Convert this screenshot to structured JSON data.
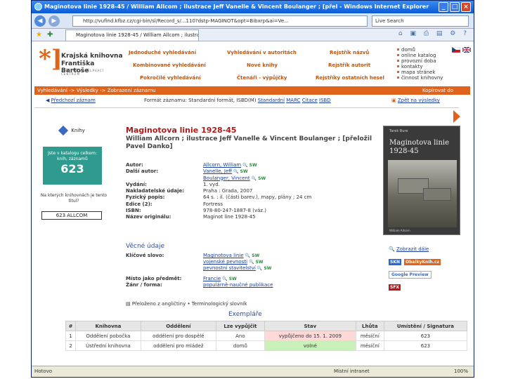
{
  "window": {
    "title": "Maginotova linie 1928-45 / William Allcom ; ilustrace Jeff Vanelle & Vincent Boulanger ; [přel - Windows Internet Explorer",
    "buttons": [
      "_",
      "□",
      "×"
    ]
  },
  "addressbar": {
    "url": "http://vufind.kfbz.cz/cgi-bin/sl/Record_s/...110?dstp-MAGINOT&opt=Bibxrp&ai=Ve...",
    "search_placeholder": "Live Search"
  },
  "tabbar": {
    "tab_label": "Maginotova linie 1928-45 / William Allcom ; ilustrace J...",
    "tools": "⌂ ▣ ⎙ ▤ ⚙ ?"
  },
  "site": {
    "logo": {
      "line1": "Krajská knihovna",
      "line2": "Františka Bartoše",
      "line3": "ZLÍNSKÉ VZDĚLÁVACÍ CENTRUM"
    },
    "menu": [
      "Jednoduché vyhledávání",
      "Vyhledávání v autoritách",
      "Rejstřík názvů",
      "Kombinované vyhledávání",
      "Nové knihy",
      "Rejstřík autorit",
      "Pokročilé vyhledávání",
      "Čtenáři - výpůjčky",
      "Rejstříky ostatních hesel"
    ],
    "toplinks": [
      "domů",
      "online katalog",
      "provozní doba",
      "kontakty",
      "mapa stránek",
      "činnost knihovny"
    ],
    "flag_colors": {
      "cz_top": "#ffffff",
      "cz_bottom": "#d7141a",
      "cz_triangle": "#11457e",
      "uk": "#012169"
    }
  },
  "breadcrumb": {
    "text": "Vyhledávání -> Výsledky -> Zobrazení záznamu",
    "right": "Kopírovat do"
  },
  "record_nav": {
    "prev": "Předchozí záznam",
    "info": "Formát záznamu: Standardní formát, ISBD(M)",
    "formats": [
      "Standardní",
      "MARC",
      "Citace",
      "ISBD"
    ],
    "save": "Zpět na výsledky"
  },
  "left": {
    "type": "Knihy",
    "green_text": "Jste v katalogu celkem:",
    "green_sub": "knih, záznamů",
    "count": "623",
    "near_text": "Na kterých knihovnách je tento titul?",
    "all_button": "623 ALLCOM"
  },
  "record": {
    "title": "Maginotova linie 1928-45",
    "author_line": "William Allcorn ; ilustrace Jeff Vanelle & Vincent Boulanger ; [přeložil Pavel Danko]",
    "fields": [
      {
        "label": "Autor:",
        "value": "Allcorn, William"
      },
      {
        "label": "Další autor:",
        "value": "Vanelle, Jeff"
      },
      {
        "label": "",
        "value": "Boulanger, Vincent"
      },
      {
        "label": "Vydání:",
        "value": "1. vyd."
      },
      {
        "label": "Nakladatelské údaje:",
        "value": "Praha : Grada, 2007"
      },
      {
        "label": "Fyzický popis:",
        "value": "64 s. : il. (části barev.), mapy, plány ; 24 cm"
      },
      {
        "label": "Edice (2):",
        "value": "Fortress"
      },
      {
        "label": "ISBN:",
        "value": "978-80-247-1887-8 (váz.)"
      },
      {
        "label": "Název originálu:",
        "value": "Maginot line 1928-45"
      }
    ],
    "subjects_heading": "Věcné údaje",
    "subjects": [
      {
        "label": "Klíčové slovo:",
        "value": "Maginotova linie"
      },
      {
        "label": "",
        "value": "vojenské pevnosti"
      },
      {
        "label": "",
        "value": "pevnostní stavitelství"
      },
      {
        "label": "Místo jako předmět:",
        "value": "Francie"
      },
      {
        "label": "Žánr / forma:",
        "value": "populárně-naučné publikace"
      }
    ],
    "note": "Přeloženo z angličtiny • Terminologický slovník"
  },
  "cover": {
    "author": "Tarek Bure",
    "title": "Maginotova linie 1928-45",
    "footer": "William Allcorn"
  },
  "sidebar": {
    "zobrazit": "Zobrazit dále",
    "services": [
      "SKN",
      "ObalkyKnih.cz"
    ],
    "google": "Google Preview",
    "sfx": "SFX"
  },
  "copies": {
    "heading": "Exempláře",
    "columns": [
      "#",
      "Knihovna",
      "Oddělení",
      "Lze vypůjčit",
      "Stav",
      "Lhůta",
      "Umístění / Signatura"
    ],
    "rows": [
      [
        "1",
        "Oddělení pobočka",
        "oddělení pro dospělé",
        "Ano",
        "vypůjčeno do 15. 1. 2009",
        "měsíční",
        "623"
      ],
      [
        "2",
        "Ústřední knihovna",
        "oddělení pro mládež",
        "domů",
        "volné",
        "měsíční",
        "623"
      ]
    ]
  },
  "status": {
    "left": "Hotovo",
    "zone": "Místní intranet",
    "zoom": "100%"
  }
}
